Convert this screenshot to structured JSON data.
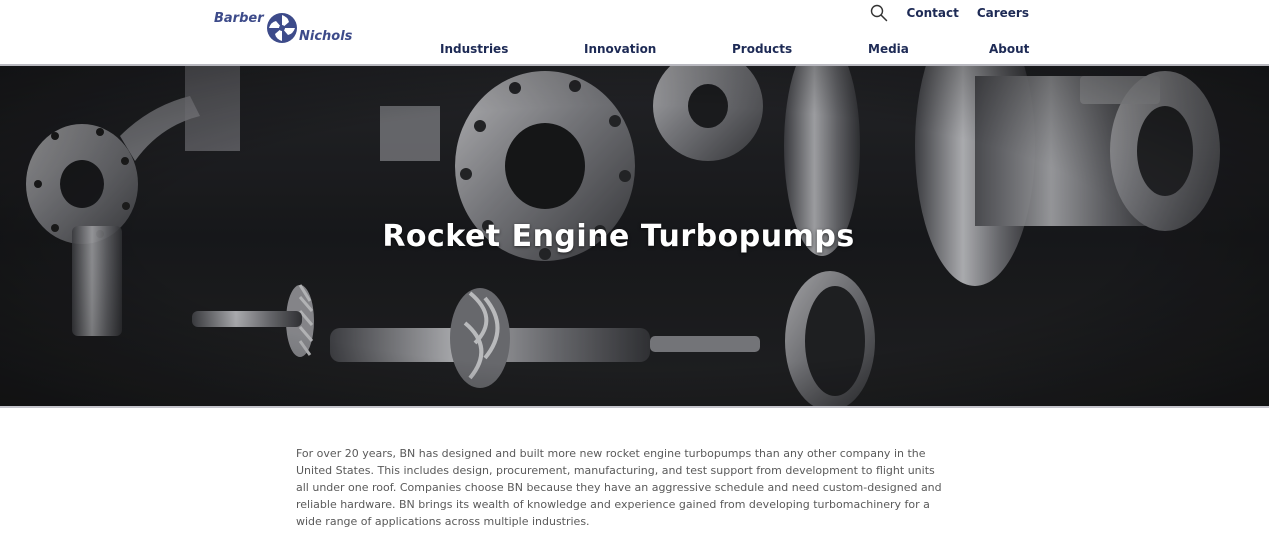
{
  "brand": {
    "name_part1": "Barber",
    "name_part2": "Nichols",
    "logo_color": "#3d4b8a"
  },
  "header": {
    "top_links": [
      {
        "label": "Contact"
      },
      {
        "label": "Careers"
      }
    ],
    "search_icon": "search-icon",
    "nav": [
      {
        "label": "Industries"
      },
      {
        "label": "Innovation"
      },
      {
        "label": "Products"
      },
      {
        "label": "Media"
      },
      {
        "label": "About"
      }
    ],
    "nav_color": "#1d2a55"
  },
  "hero": {
    "title": "Rocket Engine Turbopumps",
    "image_subject": "turbopump components and impellers on dark background"
  },
  "content": {
    "intro": "For over 20 years, BN has designed and built more new rocket engine turbopumps than any other company in the United States. This includes design, procurement, manufacturing, and test support from development to flight units all under one roof. Companies choose BN because they have an aggressive schedule and need custom-designed and reliable hardware. BN brings its wealth of knowledge and experience gained from developing turbomachinery for a wide range of applications across multiple industries."
  }
}
